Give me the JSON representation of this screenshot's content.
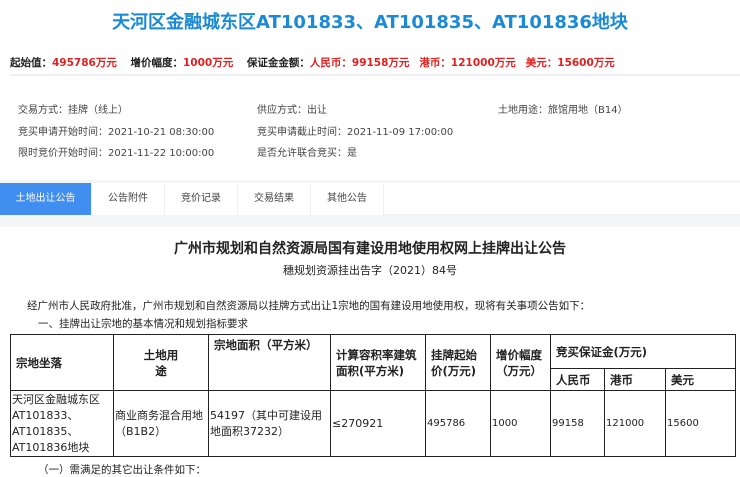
{
  "title": "天河区金融城东区AT101833、AT101835、AT101836地块",
  "summary": {
    "start_label": "起始值：",
    "start_value": "495786万元",
    "inc_label": "增价幅度：",
    "inc_value": "1000万元",
    "deposit_label": "保证金金额：",
    "rmb_label": "人民币：",
    "rmb_value": "99158万元",
    "hkd_label": "港币：",
    "hkd_value": "121000万元",
    "usd_label": "美元：",
    "usd_value": "15600万元"
  },
  "info": {
    "trade_mode": "交易方式：挂牌（线上）",
    "supply_mode": "供应方式：出让",
    "land_use": "土地用途：旅馆用地（B14）",
    "apply_start": "竞买申请开始时间：2021-10-21 08:30:00",
    "apply_end": "竞买申请截止时间：2021-11-09 17:00:00",
    "bid_start": "限时竞价开始时间：2021-11-22 10:00:00",
    "joint_bid": "是否允许联合竞买：是"
  },
  "tabs": [
    "土地出让公告",
    "公告附件",
    "竞价记录",
    "交易结果",
    "其他公告"
  ],
  "notice": {
    "heading": "广州市规划和自然资源局国有建设用地使用权网上挂牌出让公告",
    "number": "穗规划资源挂出告字（2021）84号",
    "intro": "经广州市人民政府批准，广州市规划和自然资源局以挂牌方式出让1宗地的国有建设用地使用权，现将有关事项公告如下：",
    "section1": "一、挂牌出让宗地的基本情况和规划指标要求",
    "section2": "（一）需满足的其它出让条件如下："
  },
  "table": {
    "headers": {
      "location": "宗地坐落",
      "use": "土地用途",
      "area": "宗地面积（平方米）",
      "far_area": "计算容积率建筑面积(平方米)",
      "start_price": "挂牌起始价(万元)",
      "increment": "增价幅度（万元）",
      "deposit": "竞买保证金(万元)",
      "rmb": "人民币",
      "hkd": "港币",
      "usd": "美元"
    },
    "row": {
      "location": "天河区金融城东区AT101833、AT101835、AT101836地块",
      "use": "商业商务混合用地（B1B2）",
      "area": "54197（其中可建设用地面积37232）",
      "far_area": "≤270921",
      "start_price": "495786",
      "increment": "1000",
      "rmb": "99158",
      "hkd": "121000",
      "usd": "15600"
    }
  }
}
